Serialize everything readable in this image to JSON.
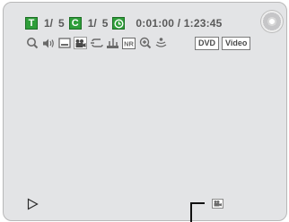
{
  "status": {
    "title_badge": "T",
    "title_current": "1/",
    "title_total": "5",
    "chapter_badge": "C",
    "chapter_current": "1/",
    "chapter_total": "5",
    "time": "0:01:00 / 1:23:45"
  },
  "icons": [
    "search-icon",
    "audio-icon",
    "subtitle-icon",
    "camera-angle-icon",
    "repeat-icon",
    "marker-icon",
    "noise-reduction-icon",
    "zoom-icon",
    "virtual-surround-icon"
  ],
  "nr_label": "NR",
  "media": {
    "disc_label": "DVD",
    "mode_label": "Video"
  },
  "colors": {
    "screen_bg": "#e3e4e6",
    "badge_green": "#2f9e3a",
    "text_gray": "#5a5a5a"
  }
}
